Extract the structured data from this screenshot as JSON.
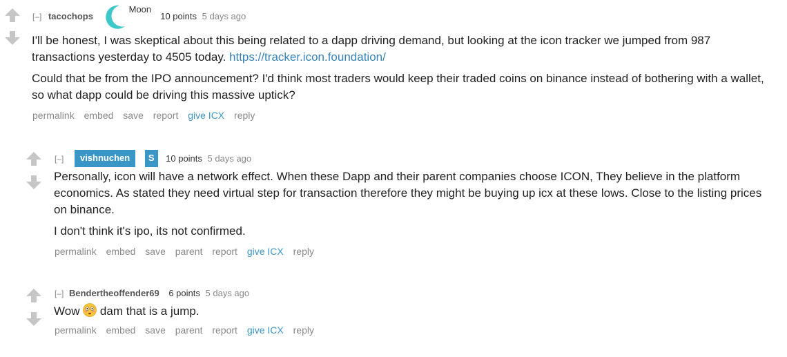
{
  "comments": [
    {
      "collapse": "[–]",
      "author": "tacochops",
      "flair_text": "Moon",
      "points": "10 points",
      "time": "5 days ago",
      "body_para1_pre": "I'll be honest, I was skeptical about this being related to a dapp driving demand, but looking at the icon tracker we jumped from 987 transactions yesterday to 4505 today. ",
      "body_link": "https://tracker.icon.foundation/",
      "body_para2": "Could that be from the IPO announcement? I'd think most traders would keep their traded coins on binance instead of bothering with a wallet, so what dapp could be driving this massive uptick?",
      "buttons": {
        "permalink": "permalink",
        "embed": "embed",
        "save": "save",
        "report": "report",
        "give": "give ICX",
        "reply": "reply"
      }
    },
    {
      "collapse": "[–]",
      "author": "vishnuchen",
      "badge": "S",
      "points": "10 points",
      "time": "5 days ago",
      "body_para1": "Personally, icon will have a network effect. When these Dapp and their parent companies choose ICON, They believe in the platform economics. As stated they need virtual step for transaction therefore they might be buying up icx at these lows. Close to the listing prices on binance.",
      "body_para2": "I don't think it's ipo, its not confirmed.",
      "buttons": {
        "permalink": "permalink",
        "embed": "embed",
        "save": "save",
        "parent": "parent",
        "report": "report",
        "give": "give ICX",
        "reply": "reply"
      }
    },
    {
      "collapse": "[–]",
      "author": "Bendertheoffender69",
      "points": "6 points",
      "time": "5 days ago",
      "body_pre": "Wow ",
      "body_emoji": "flushed-face-icon",
      "body_post": " dam that is a jump.",
      "buttons": {
        "permalink": "permalink",
        "embed": "embed",
        "save": "save",
        "parent": "parent",
        "report": "report",
        "give": "give ICX",
        "reply": "reply"
      }
    }
  ],
  "colors": {
    "link": "#3684b9",
    "flair_bg": "#3a96c6",
    "moon": "#3dc9c9",
    "arrow": "#c6c6c6"
  }
}
